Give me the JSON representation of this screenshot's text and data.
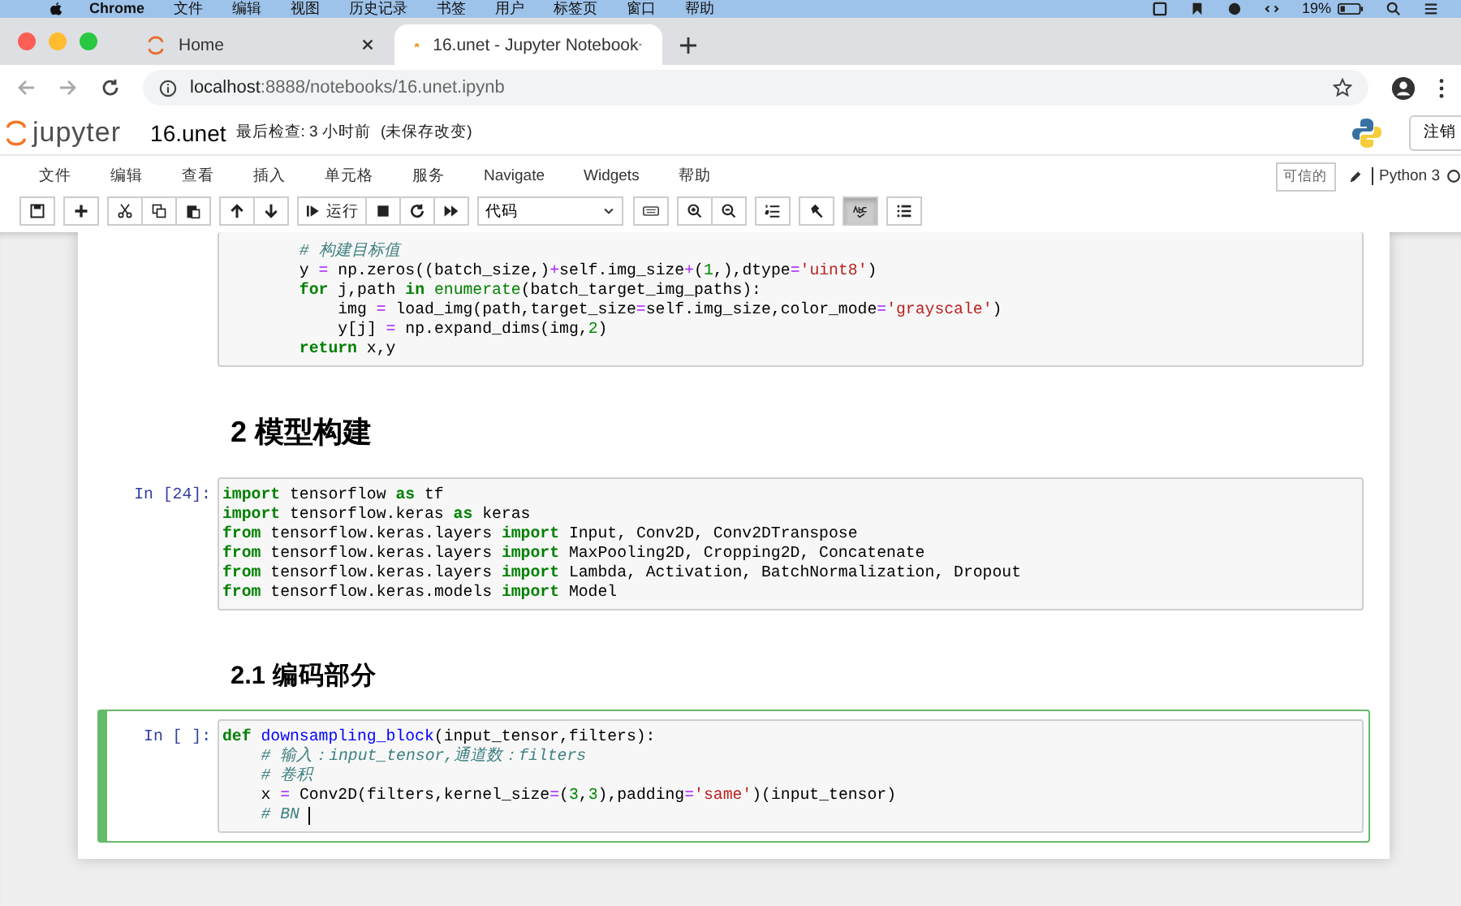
{
  "mac_menu": {
    "app": "Chrome",
    "items": [
      "文件",
      "编辑",
      "视图",
      "历史记录",
      "书签",
      "用户",
      "标签页",
      "窗口",
      "帮助"
    ],
    "battery": "19%"
  },
  "browser_tabs": [
    {
      "title": "Home",
      "selected": false
    },
    {
      "title": "16.unet - Jupyter Notebook",
      "selected": true
    }
  ],
  "address": {
    "host": "localhost",
    "rest": ":8888/notebooks/16.unet.ipynb"
  },
  "header": {
    "logo": "jupyter",
    "name": "16.unet",
    "checkpoint": "最后检查: 3 小时前",
    "unsaved": "(未保存改变)",
    "logout": "注销"
  },
  "menu": {
    "items": [
      "文件",
      "编辑",
      "查看",
      "插入",
      "单元格",
      "服务",
      "Navigate",
      "Widgets",
      "帮助"
    ],
    "trusted": "可信的",
    "kernel": "Python 3"
  },
  "toolbar": {
    "run_label": "运行",
    "cell_type": "代码",
    "spellcheck_active": true
  },
  "cells": [
    {
      "kind": "code",
      "selected": false,
      "cursor": false,
      "lines": [
        "        # 构建目标值",
        "        y = np.zeros((batch_size,)+self.img_size+(1,),dtype='uint8')",
        "        for j,path in enumerate(batch_target_img_paths):",
        "            img = load_img(path,target_size=self.img_size,color_mode='grayscale')",
        "            y[j] = np.expand_dims(img,2)",
        "        return x,y"
      ]
    },
    {
      "kind": "h1",
      "text": "2  模型构建"
    },
    {
      "kind": "code",
      "prompt": "In [24]:",
      "selected": false,
      "cursor": false,
      "lines": [
        "import tensorflow as tf",
        "import tensorflow.keras as keras",
        "from tensorflow.keras.layers import Input, Conv2D, Conv2DTranspose",
        "from tensorflow.keras.layers import MaxPooling2D, Cropping2D, Concatenate",
        "from tensorflow.keras.layers import Lambda, Activation, BatchNormalization, Dropout",
        "from tensorflow.keras.models import Model"
      ]
    },
    {
      "kind": "h2",
      "text": "2.1  编码部分"
    },
    {
      "kind": "code",
      "prompt": "In [ ]:",
      "selected": true,
      "cursor": true,
      "lines": [
        "def downsampling_block(input_tensor,filters):",
        "    # 输入：input_tensor,通道数：filters",
        "    # 卷积",
        "    x = Conv2D(filters,kernel_size=(3,3),padding='same')(input_tensor)",
        "    # BN"
      ]
    }
  ]
}
